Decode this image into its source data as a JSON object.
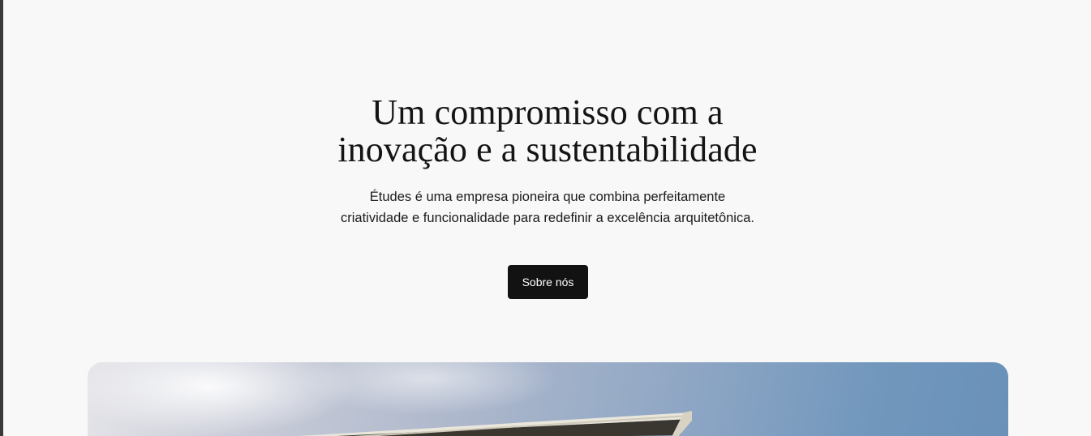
{
  "hero": {
    "title_line1": "Um compromisso com a",
    "title_line2": "inovação e a sustentabilidade",
    "description": "Études é uma empresa pioneira que combina perfeitamente criatividade e funcionalidade para redefinir a excelência arquitetônica.",
    "button_label": "Sobre nós"
  },
  "colors": {
    "background": "#f8f8f8",
    "button_bg": "#121212",
    "button_text": "#ffffff",
    "sky": "#7197bd"
  }
}
